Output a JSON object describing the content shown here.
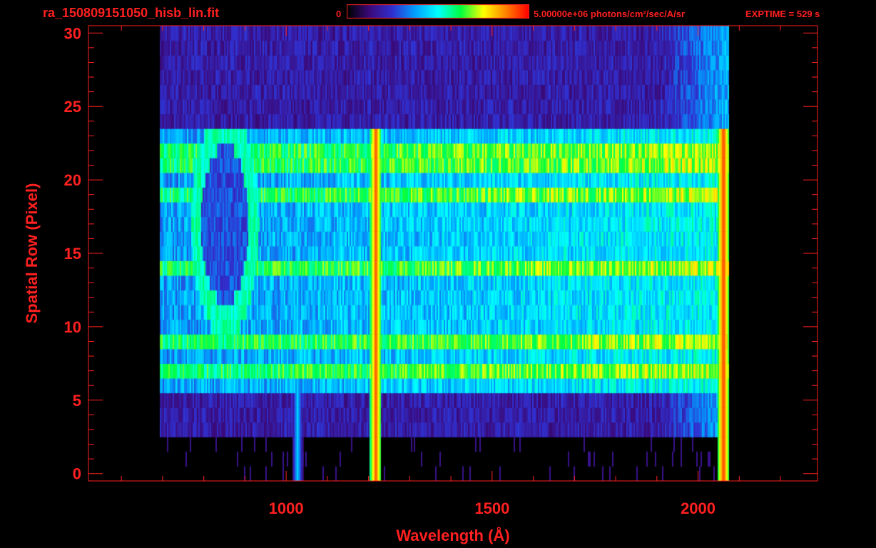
{
  "header": {
    "filename": "ra_150809151050_hisb_lin.fit",
    "colorbar_min_label": "0",
    "colorbar_max_label": "5.00000e+06 photons/cm²/sec/A/sr",
    "exptime_label": "EXPTIME = 529 s"
  },
  "colors": {
    "axis": "#ff2020",
    "background": "#000000",
    "colormap": [
      "#000000",
      "#3a0a7a",
      "#3030d0",
      "#00a0ff",
      "#00ffff",
      "#00ff40",
      "#ffff00",
      "#ff8000",
      "#ff0000"
    ]
  },
  "chart_data": {
    "type": "heatmap",
    "title": "ra_150809151050_hisb_lin.fit",
    "xlabel": "Wavelength (Å)",
    "ylabel": "Spatial Row (Pixel)",
    "xlim": [
      520,
      2290
    ],
    "ylim": [
      -0.5,
      30.5
    ],
    "x_ticks": [
      1000,
      1500,
      2000
    ],
    "x_tick_labels": [
      "1000",
      "1500",
      "2000"
    ],
    "y_ticks": [
      0,
      5,
      10,
      15,
      20,
      25,
      30
    ],
    "y_tick_labels": [
      "0",
      "5",
      "10",
      "15",
      "20",
      "25",
      "30"
    ],
    "colorbar": {
      "min": 0,
      "max": 5000000,
      "units": "photons/cm²/sec/A/sr"
    },
    "spectrum_range": [
      690,
      2065
    ],
    "bright_rows": [
      22,
      21,
      19,
      14,
      9,
      7
    ],
    "slit_rows": [
      6,
      23
    ],
    "emission_lines": [
      {
        "wavelength": 1216,
        "intensity": 0.92
      },
      {
        "wavelength": 1026,
        "intensity": 0.45
      },
      {
        "wavelength": 2060,
        "intensity": 0.95
      }
    ],
    "grid": false
  }
}
